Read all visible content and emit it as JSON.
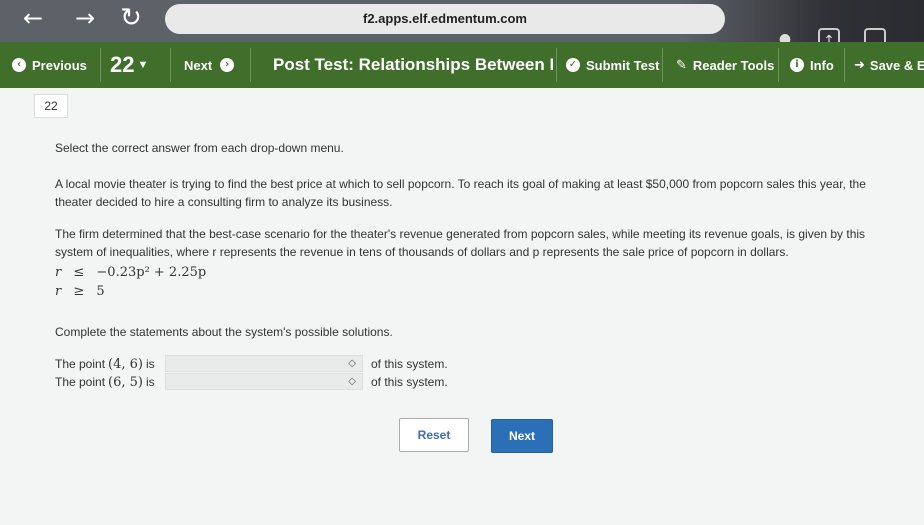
{
  "browser": {
    "url": "f2.apps.elf.edmentum.com",
    "back_glyph": "←",
    "forward_glyph": "→",
    "reload_glyph": "↻"
  },
  "toolbar": {
    "previous_label": "Previous",
    "question_number": "22",
    "next_label": "Next",
    "title": "Post Test: Relationships Between Func",
    "submit_label": "Submit Test",
    "reader_tools_label": "Reader Tools",
    "info_label": "Info",
    "save_label": "Save & E",
    "accent_color": "#3f6f2a"
  },
  "question": {
    "number_badge": "22",
    "instruction": "Select the correct answer from each drop-down menu.",
    "para1_line1": "A local movie theater is trying to find the best price at which to sell popcorn. To reach its goal of making at least $50,000 from popcorn sales this year, the",
    "para1_line2": "theater decided to hire a consulting firm to analyze its business.",
    "para2_line1": "The firm determined that the best-case scenario for the theater's revenue generated from popcorn sales, while meeting its revenue goals, is given by this",
    "para2_line2": "system of inequalities, where r represents the revenue in tens of thousands of dollars and p represents the sale price of popcorn in dollars.",
    "ineq1_lhs": "r",
    "ineq1_op": "≤",
    "ineq1_rhs": "−0.23p² + 2.25p",
    "ineq2_lhs": "r",
    "ineq2_op": "≥",
    "ineq2_rhs": "5",
    "complete_text": "Complete the statements about the system's possible solutions.",
    "stmt1_prefix": "The point",
    "stmt1_point": "(4, 6)",
    "stmt1_is": "is",
    "stmt1_suffix": "of this system.",
    "stmt2_prefix": "The point",
    "stmt2_point": "(6, 5)",
    "stmt2_is": "is",
    "stmt2_suffix": "of this system.",
    "select_arrow": "◇"
  },
  "buttons": {
    "reset_label": "Reset",
    "next_label": "Next"
  }
}
